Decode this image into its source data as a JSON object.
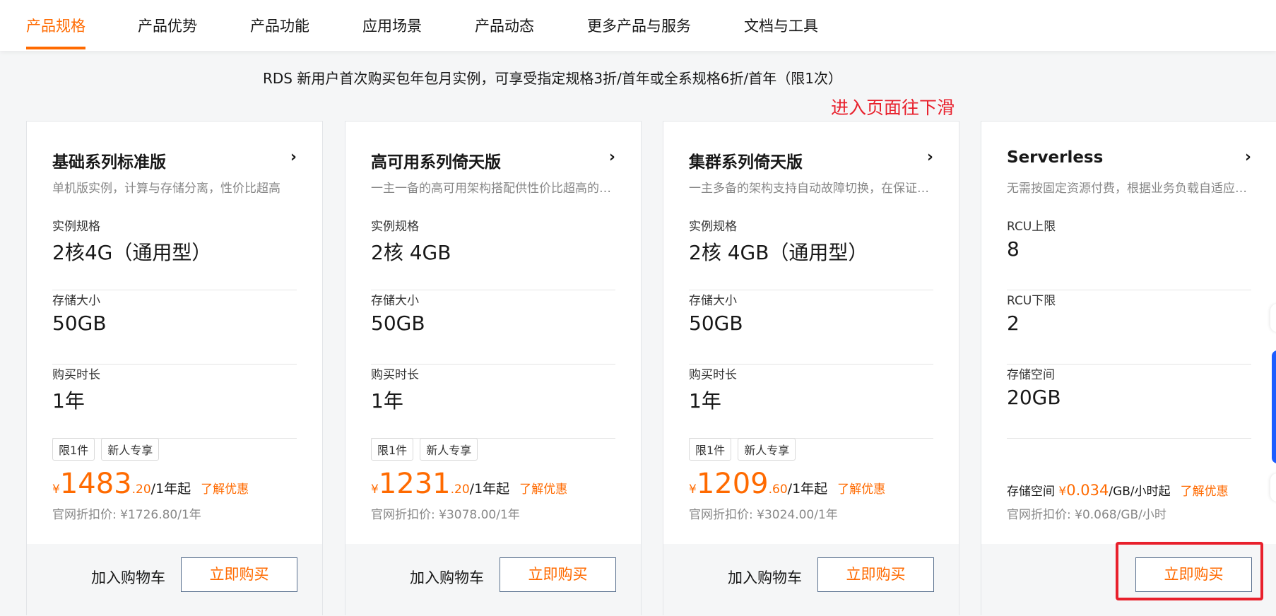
{
  "nav": {
    "tabs": [
      "产品规格",
      "产品优势",
      "产品功能",
      "应用场景",
      "产品动态",
      "更多产品与服务",
      "文档与工具"
    ]
  },
  "promo_text": "RDS 新用户首次购买包年包月实例，可享受指定规格3折/首年或全系规格6折/首年（限1次）",
  "annotation_text": "进入页面往下滑",
  "cards": [
    {
      "title": "基础系列标准版",
      "desc": "单机版实例，计算与存储分离，性价比超高",
      "specs": [
        {
          "label": "实例规格",
          "value": "2核4G（通用型）"
        },
        {
          "label": "存储大小",
          "value": "50GB"
        },
        {
          "label": "购买时长",
          "value": "1年"
        }
      ],
      "badges": [
        "限1件",
        "新人专享"
      ],
      "price_yen": "¥",
      "price_int": "1483",
      "price_dec": ".20",
      "price_unit": "/1年起",
      "discount_link": "了解优惠",
      "orig_price": "官网折扣价: ¥1726.80/1年",
      "cart_label": "加入购物车",
      "buy_label": "立即购买"
    },
    {
      "title": "高可用系列倚天版",
      "desc": "一主一备的高可用架构搭配供性价比超高的倚天实例",
      "specs": [
        {
          "label": "实例规格",
          "value": "2核 4GB"
        },
        {
          "label": "存储大小",
          "value": "50GB"
        },
        {
          "label": "购买时长",
          "value": "1年"
        }
      ],
      "badges": [
        "限1件",
        "新人专享"
      ],
      "price_yen": "¥",
      "price_int": "1231",
      "price_dec": ".20",
      "price_unit": "/1年起",
      "discount_link": "了解优惠",
      "orig_price": "官网折扣价: ¥3078.00/1年",
      "cart_label": "加入购物车",
      "buy_label": "立即购买"
    },
    {
      "title": "集群系列倚天版",
      "desc": "一主多备的架构支持自动故障切换，在保证高可用的同时",
      "specs": [
        {
          "label": "实例规格",
          "value": "2核 4GB（通用型）"
        },
        {
          "label": "存储大小",
          "value": "50GB"
        },
        {
          "label": "购买时长",
          "value": "1年"
        }
      ],
      "badges": [
        "限1件",
        "新人专享"
      ],
      "price_yen": "¥",
      "price_int": "1209",
      "price_dec": ".60",
      "price_unit": "/1年起",
      "discount_link": "了解优惠",
      "orig_price": "官网折扣价: ¥3024.00/1年",
      "cart_label": "加入购物车",
      "buy_label": "立即购买"
    },
    {
      "title": "Serverless",
      "desc": "无需按固定资源付费，根据业务负载自适应调整资源",
      "specs": [
        {
          "label": "RCU上限",
          "value": "8"
        },
        {
          "label": "RCU下限",
          "value": "2"
        },
        {
          "label": "存储空间",
          "value": "20GB"
        }
      ],
      "price_prefix": "存储空间",
      "price_yen": "¥",
      "price_num": "0.034",
      "price_unit": "/GB/小时起",
      "discount_link": "了解优惠",
      "orig_price": "官网折扣价: ¥0.068/GB/小时",
      "buy_label": "立即购买"
    }
  ]
}
